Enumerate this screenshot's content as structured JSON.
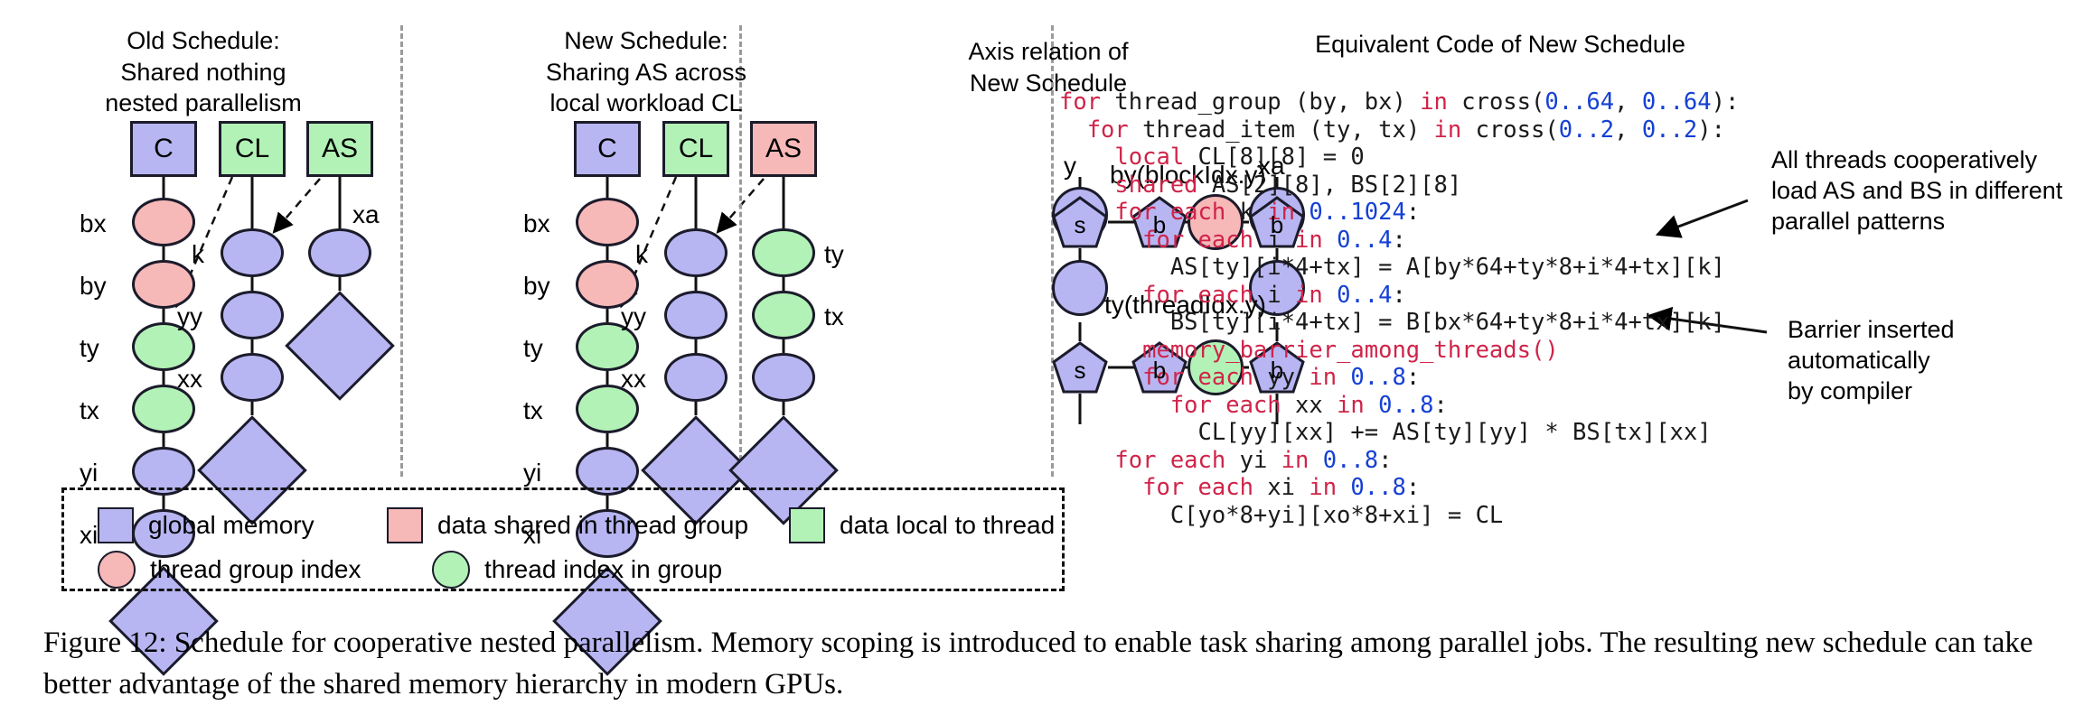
{
  "panels": {
    "old": {
      "title": "Old Schedule:\nShared nothing\nnested parallelism"
    },
    "new": {
      "title": "New Schedule:\nSharing AS across\nlocal workload CL"
    },
    "axis": {
      "title": "Axis relation of\nNew Schedule"
    },
    "code": {
      "title": "Equivalent Code of New Schedule"
    }
  },
  "old_schedule": {
    "roots": [
      {
        "label": "C",
        "color": "blue"
      },
      {
        "label": "CL",
        "color": "green"
      },
      {
        "label": "AS",
        "color": "green"
      }
    ],
    "chain_c": [
      {
        "axis": "bx",
        "color": "pink"
      },
      {
        "axis": "by",
        "color": "pink"
      },
      {
        "axis": "ty",
        "color": "green"
      },
      {
        "axis": "tx",
        "color": "green"
      },
      {
        "axis": "yi",
        "color": "blue"
      },
      {
        "axis": "xi",
        "color": "blue"
      }
    ],
    "chain_cl": [
      {
        "axis": "k",
        "color": "blue"
      },
      {
        "axis": "yy",
        "color": "blue"
      },
      {
        "axis": "xx",
        "color": "blue"
      }
    ],
    "chain_as": [
      {
        "axis": "xa",
        "color": "blue"
      }
    ]
  },
  "new_schedule": {
    "roots": [
      {
        "label": "C",
        "color": "blue"
      },
      {
        "label": "CL",
        "color": "green"
      },
      {
        "label": "AS",
        "color": "pink"
      }
    ],
    "chain_c": [
      {
        "axis": "bx",
        "color": "pink"
      },
      {
        "axis": "by",
        "color": "pink"
      },
      {
        "axis": "ty",
        "color": "green"
      },
      {
        "axis": "tx",
        "color": "green"
      },
      {
        "axis": "yi",
        "color": "blue"
      },
      {
        "axis": "xi",
        "color": "blue"
      }
    ],
    "chain_cl": [
      {
        "axis": "k",
        "color": "blue"
      },
      {
        "axis": "yy",
        "color": "blue"
      },
      {
        "axis": "xx",
        "color": "blue"
      }
    ],
    "chain_as": [
      {
        "axis": "ty",
        "color": "green"
      },
      {
        "axis": "tx",
        "color": "green"
      },
      {
        "axis": "",
        "color": "blue"
      }
    ]
  },
  "axis_relation": {
    "left_label": "y",
    "right_label": "xa",
    "row_labels": [
      "by(blockIdx.y)",
      "ty(threadIdx.y)"
    ],
    "node_glyphs": {
      "split": "s",
      "bind": "b"
    },
    "row1_center_color": "pink",
    "row2_center_color": "green"
  },
  "code": {
    "lines": [
      [
        {
          "t": "for ",
          "c": "kw"
        },
        {
          "t": "thread_group (by, bx) ",
          "c": ""
        },
        {
          "t": "in ",
          "c": "kw"
        },
        {
          "t": "cross(",
          "c": ""
        },
        {
          "t": "0..64",
          "c": "num"
        },
        {
          "t": ", ",
          "c": ""
        },
        {
          "t": "0..64",
          "c": "num"
        },
        {
          "t": "):",
          "c": ""
        }
      ],
      [
        {
          "t": "  for ",
          "c": "kw"
        },
        {
          "t": "thread_item (ty, tx) ",
          "c": ""
        },
        {
          "t": "in ",
          "c": "kw"
        },
        {
          "t": "cross(",
          "c": ""
        },
        {
          "t": "0..2",
          "c": "num"
        },
        {
          "t": ", ",
          "c": ""
        },
        {
          "t": "0..2",
          "c": "num"
        },
        {
          "t": "):",
          "c": ""
        }
      ],
      [
        {
          "t": "    local ",
          "c": "kw"
        },
        {
          "t": "CL[8][8] = 0",
          "c": ""
        }
      ],
      [
        {
          "t": "    shared ",
          "c": "kw"
        },
        {
          "t": "AS[2][8], BS[2][8]",
          "c": ""
        }
      ],
      [
        {
          "t": "    for each ",
          "c": "kw"
        },
        {
          "t": "k ",
          "c": ""
        },
        {
          "t": "in ",
          "c": "kw"
        },
        {
          "t": "0..1024",
          "c": "num"
        },
        {
          "t": ":",
          "c": ""
        }
      ],
      [
        {
          "t": "      for each ",
          "c": "kw"
        },
        {
          "t": "i ",
          "c": ""
        },
        {
          "t": "in ",
          "c": "kw"
        },
        {
          "t": "0..4",
          "c": "num"
        },
        {
          "t": ":",
          "c": ""
        }
      ],
      [
        {
          "t": "        AS[ty][i*4+tx] = A[by*64+ty*8+i*4+tx][k]",
          "c": ""
        }
      ],
      [
        {
          "t": "      for each ",
          "c": "kw"
        },
        {
          "t": "i ",
          "c": ""
        },
        {
          "t": "in ",
          "c": "kw"
        },
        {
          "t": "0..4",
          "c": "num"
        },
        {
          "t": ":",
          "c": ""
        }
      ],
      [
        {
          "t": "        BS[ty][i*4+tx] = B[bx*64+ty*8+i*4+tx][k]",
          "c": ""
        }
      ],
      [
        {
          "t": "      memory_barrier_among_threads()",
          "c": "kw"
        }
      ],
      [
        {
          "t": "      for each ",
          "c": "kw"
        },
        {
          "t": "yy ",
          "c": ""
        },
        {
          "t": "in ",
          "c": "kw"
        },
        {
          "t": "0..8",
          "c": "num"
        },
        {
          "t": ":",
          "c": ""
        }
      ],
      [
        {
          "t": "        for each ",
          "c": "kw"
        },
        {
          "t": "xx ",
          "c": ""
        },
        {
          "t": "in ",
          "c": "kw"
        },
        {
          "t": "0..8",
          "c": "num"
        },
        {
          "t": ":",
          "c": ""
        }
      ],
      [
        {
          "t": "          CL[yy][xx] += AS[ty][yy] * BS[tx][xx]",
          "c": ""
        }
      ],
      [
        {
          "t": "    for each ",
          "c": "kw"
        },
        {
          "t": "yi ",
          "c": ""
        },
        {
          "t": "in ",
          "c": "kw"
        },
        {
          "t": "0..8",
          "c": "num"
        },
        {
          "t": ":",
          "c": ""
        }
      ],
      [
        {
          "t": "      for each ",
          "c": "kw"
        },
        {
          "t": "xi ",
          "c": ""
        },
        {
          "t": "in ",
          "c": "kw"
        },
        {
          "t": "0..8",
          "c": "num"
        },
        {
          "t": ":",
          "c": ""
        }
      ],
      [
        {
          "t": "        C[yo*8+yi][xo*8+xi] = CL",
          "c": ""
        }
      ]
    ]
  },
  "annotations": {
    "load_note": "All threads cooperatively\nload AS and BS in different\nparallel patterns",
    "barrier_note": "Barrier inserted automatically\nby compiler"
  },
  "legend": {
    "items": [
      {
        "shape": "square",
        "color": "blue",
        "label": "global memory"
      },
      {
        "shape": "square",
        "color": "pink",
        "label": "data shared in thread group"
      },
      {
        "shape": "square",
        "color": "green",
        "label": "data local to thread"
      },
      {
        "shape": "circle",
        "color": "pink",
        "label": "thread group index"
      },
      {
        "shape": "circle",
        "color": "green",
        "label": "thread index in group"
      }
    ]
  },
  "caption": "Figure 12: Schedule for cooperative nested parallelism. Memory scoping is introduced to enable task sharing among parallel jobs. The resulting new schedule can take better advantage of the shared memory hierarchy in modern GPUs.",
  "colors": {
    "blue": "#b7b6f2",
    "pink": "#f7b8b8",
    "green": "#b2f2b6",
    "stroke": "#1b1b2b",
    "keyword": "#cf2449",
    "number": "#1540d4",
    "divider": "#9a9a9a"
  }
}
